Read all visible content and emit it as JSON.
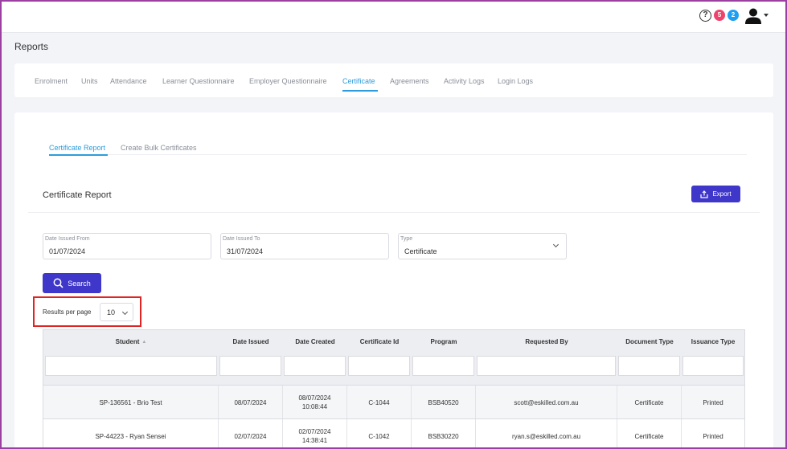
{
  "topbar": {
    "help_glyph": "?",
    "notif_red": "5",
    "notif_blue": "2",
    "icons": [
      "help-icon",
      "user-icon"
    ]
  },
  "page": {
    "title": "Reports"
  },
  "tabs": [
    "Enrolment",
    "Units",
    "Attendance",
    "Learner Questionnaire",
    "Employer Questionnaire",
    "Certificate",
    "Agreements",
    "Activity Logs",
    "Login Logs"
  ],
  "subtabs": [
    "Certificate Report",
    "Create Bulk Certificates"
  ],
  "card": {
    "title": "Certificate Report",
    "export_label": "Export"
  },
  "filters": {
    "date_from": {
      "label": "Date Issued From",
      "value": "01/07/2024"
    },
    "date_to": {
      "label": "Date Issued To",
      "value": "31/07/2024"
    },
    "type": {
      "label": "Type",
      "value": "Certificate"
    }
  },
  "search_label": "Search",
  "results_per_page": {
    "label": "Results per page",
    "value": "10"
  },
  "table": {
    "headers": [
      "Student",
      "Date Issued",
      "Date Created",
      "Certificate Id",
      "Program",
      "Requested By",
      "Document Type",
      "Issuance Type"
    ],
    "rows": [
      {
        "student": "SP-136561 - Brio Test",
        "date_issued": "08/07/2024",
        "date_created_date": "08/07/2024",
        "date_created_time": "10:08:44",
        "certificate_id": "C-1044",
        "program": "BSB40520",
        "requested_by": "scott@eskilled.com.au",
        "document_type": "Certificate",
        "issuance_type": "Printed"
      },
      {
        "student": "SP-44223 - Ryan Sensei",
        "date_issued": "02/07/2024",
        "date_created_date": "02/07/2024",
        "date_created_time": "14:38:41",
        "certificate_id": "C-1042",
        "program": "BSB30220",
        "requested_by": "ryan.s@eskilled.com.au",
        "document_type": "Certificate",
        "issuance_type": "Printed"
      }
    ]
  },
  "colors": {
    "accent": "#2d9cdb",
    "primary_button": "#3f37c9",
    "highlight_box": "#e02424",
    "badge_red": "#f0436b",
    "badge_blue": "#1e9ff2"
  }
}
